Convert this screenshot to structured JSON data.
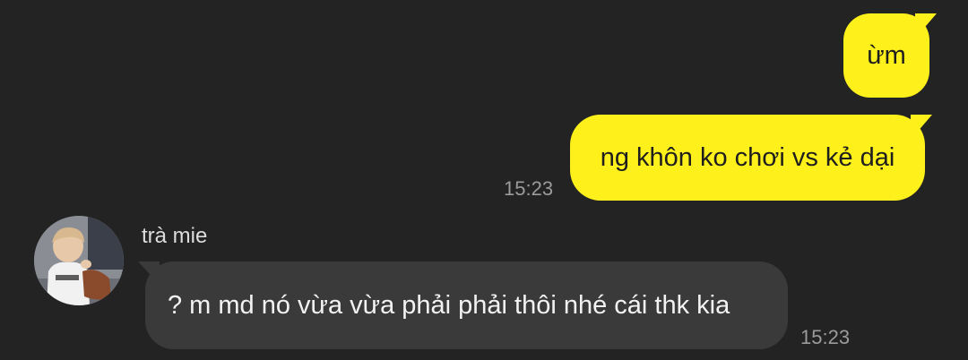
{
  "conversation": {
    "messages": [
      {
        "direction": "outgoing",
        "text": "ừm"
      },
      {
        "direction": "outgoing",
        "text": "ng khôn ko chơi vs kẻ dại",
        "time": "15:23"
      },
      {
        "direction": "incoming",
        "sender": "trà mie",
        "avatar_icon": "user-avatar-photo",
        "text": "? m md nó vừa vừa phải phải thôi nhé cái thk kia",
        "time": "15:23"
      }
    ]
  },
  "colors": {
    "background": "#232323",
    "outgoing_bubble": "#fef01b",
    "incoming_bubble": "#3a3a3a",
    "timestamp": "#9b9b9b"
  }
}
